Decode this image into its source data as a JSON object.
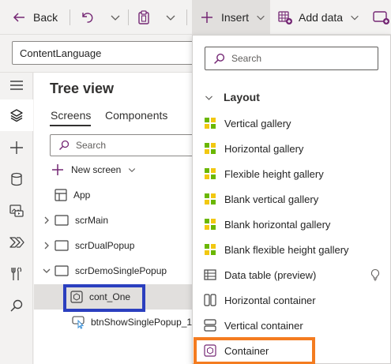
{
  "toolbar": {
    "back_label": "Back",
    "insert_label": "Insert",
    "add_data_label": "Add data"
  },
  "formula_bar": {
    "property": "ContentLanguage"
  },
  "tree_view": {
    "title": "Tree view",
    "tabs": [
      {
        "label": "Screens",
        "active": true
      },
      {
        "label": "Components",
        "active": false
      }
    ],
    "search_placeholder": "Search",
    "new_screen_label": "New screen",
    "nodes": [
      {
        "label": "App",
        "type": "app"
      },
      {
        "label": "scrMain",
        "type": "screen",
        "expanded": false
      },
      {
        "label": "scrDualPopup",
        "type": "screen",
        "expanded": false
      },
      {
        "label": "scrDemoSinglePopup",
        "type": "screen",
        "expanded": true
      },
      {
        "label": "cont_One",
        "type": "container",
        "selected": true
      },
      {
        "label": "btnShowSinglePopup_1",
        "type": "button"
      }
    ]
  },
  "insert_menu": {
    "search_placeholder": "Search",
    "section": "Layout",
    "items": [
      {
        "label": "Vertical gallery",
        "icon": "gallery-icon"
      },
      {
        "label": "Horizontal gallery",
        "icon": "gallery-icon"
      },
      {
        "label": "Flexible height gallery",
        "icon": "gallery-icon"
      },
      {
        "label": "Blank vertical gallery",
        "icon": "gallery-icon"
      },
      {
        "label": "Blank horizontal gallery",
        "icon": "gallery-icon"
      },
      {
        "label": "Blank flexible height gallery",
        "icon": "gallery-icon"
      },
      {
        "label": "Data table (preview)",
        "icon": "table-icon"
      },
      {
        "label": "Horizontal container",
        "icon": "horizontal-container-icon"
      },
      {
        "label": "Vertical container",
        "icon": "vertical-container-icon"
      },
      {
        "label": "Container",
        "icon": "container-icon"
      }
    ]
  },
  "colors": {
    "gallery_green": "#6bb700",
    "gallery_yellow": "#f2c811",
    "container_purple": "#742774",
    "highlight_blue": "#2b3fbf",
    "highlight_orange": "#f47c20"
  }
}
